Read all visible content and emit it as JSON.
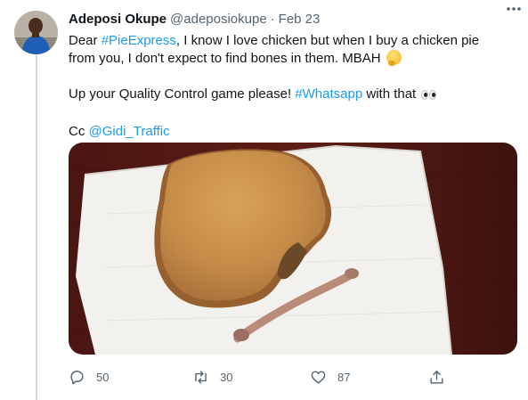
{
  "user": {
    "display_name": "Adeposi Okupe",
    "handle": "@adeposiokupe",
    "separator": "·",
    "date": "Feb 23"
  },
  "tweet": {
    "p1_a": "Dear ",
    "p1_link": "#PieExpress",
    "p1_b": ", I know I love chicken but when I buy a chicken pie from you, I don't expect to find bones in them. MBAH",
    "p2_a": "Up your Quality Control game please! ",
    "p2_link": "#Whatsapp",
    "p2_b": " with that",
    "p3_a": "Cc ",
    "p3_link": "@Gidi_Traffic"
  },
  "actions": {
    "reply_count": "50",
    "retweet_count": "30",
    "like_count": "87"
  },
  "colors": {
    "link": "#1d9bf0",
    "secondary_text": "#536471",
    "thread_line": "#cfd9de"
  },
  "icons": [
    "more-icon",
    "reply-icon",
    "retweet-icon",
    "like-icon",
    "share-icon",
    "thinking-face-emoji",
    "eyes-emoji"
  ]
}
